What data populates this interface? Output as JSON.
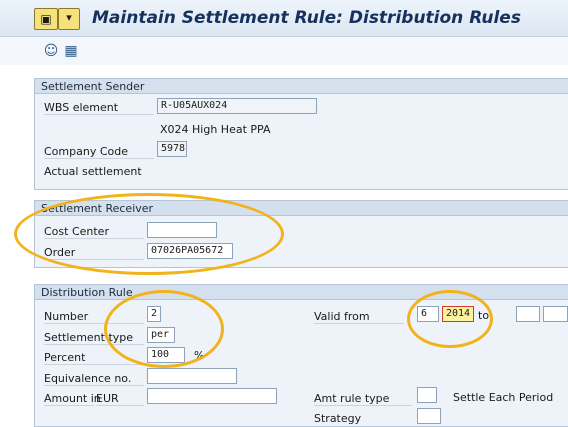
{
  "window": {
    "title": "Maintain Settlement Rule: Distribution Rules"
  },
  "toolbar": {
    "icons": [
      "person-icon",
      "org-structure-icon"
    ]
  },
  "sender": {
    "heading": "Settlement Sender",
    "wbs_label": "WBS element",
    "wbs_value": "R-U05AUX024",
    "wbs_description": "X024 High Heat PPA",
    "company_code_label": "Company Code",
    "company_code_value": "5978",
    "settlement_type_text": "Actual settlement"
  },
  "receiver": {
    "heading": "Settlement Receiver",
    "cost_center_label": "Cost Center",
    "cost_center_value": "",
    "order_label": "Order",
    "order_value": "07026PA05672"
  },
  "distribution": {
    "heading": "Distribution Rule",
    "number_label": "Number",
    "number_value": "2",
    "settlement_type_label": "Settlement type",
    "settlement_type_value": "per",
    "percent_label": "Percent",
    "percent_value": "100",
    "percent_unit": "%",
    "equivalence_label": "Equivalence no.",
    "equivalence_value": "",
    "amount_label": "Amount in",
    "amount_currency": "EUR",
    "amount_value": "",
    "valid_from_label": "Valid from",
    "valid_from_period": "6",
    "valid_from_year": "2014",
    "to_label": "to",
    "valid_to_period": "",
    "valid_to_year": "",
    "amt_rule_type_label": "Amt rule type",
    "amt_rule_type_value": "",
    "settle_each_period_label": "Settle Each Period",
    "strategy_label": "Strategy",
    "strategy_value": ""
  },
  "colors": {
    "highlight_ring": "#f2b21a",
    "title": "#16325c",
    "group_bg": "#eef3f9"
  }
}
